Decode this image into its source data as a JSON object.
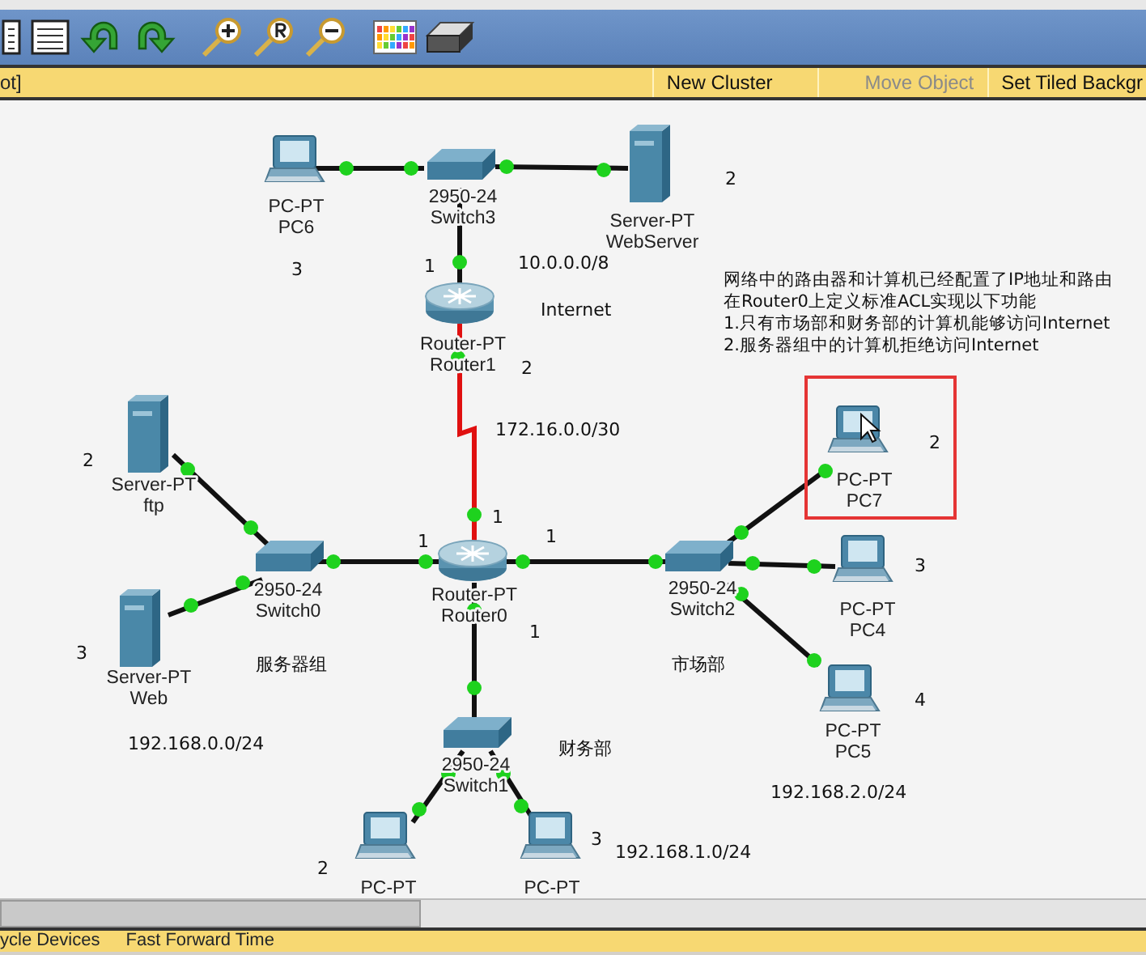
{
  "action_bar": {
    "left_text": "ot]",
    "buttons": [
      {
        "label": "New Cluster",
        "disabled": false
      },
      {
        "label": "Move Object",
        "disabled": true
      },
      {
        "label": "Set Tiled Backgr",
        "disabled": false
      }
    ]
  },
  "devices": [
    {
      "kind": "pc",
      "model": "PC-PT",
      "name": "PC6",
      "selected": false
    },
    {
      "kind": "switch",
      "model": "2950-24",
      "name": "Switch3",
      "selected": false
    },
    {
      "kind": "server",
      "model": "Server-PT",
      "name": "WebServer",
      "selected": false
    },
    {
      "kind": "router",
      "model": "Router-PT",
      "name": "Router1",
      "selected": false
    },
    {
      "kind": "server",
      "model": "Server-PT",
      "name": "ftp",
      "selected": false
    },
    {
      "kind": "switch",
      "model": "2950-24",
      "name": "Switch0",
      "selected": false
    },
    {
      "kind": "router",
      "model": "Router-PT",
      "name": "Router0",
      "selected": false
    },
    {
      "kind": "switch",
      "model": "2950-24",
      "name": "Switch2",
      "selected": false
    },
    {
      "kind": "pc",
      "model": "PC-PT",
      "name": "PC7",
      "selected": true
    },
    {
      "kind": "pc",
      "model": "PC-PT",
      "name": "PC4",
      "selected": false
    },
    {
      "kind": "server",
      "model": "Server-PT",
      "name": "Web",
      "selected": false
    },
    {
      "kind": "pc",
      "model": "PC-PT",
      "name": "PC5",
      "selected": false
    },
    {
      "kind": "switch",
      "model": "2950-24",
      "name": "Switch1",
      "selected": false
    },
    {
      "kind": "pc",
      "model": "PC-PT",
      "selected": false
    },
    {
      "kind": "pc",
      "model": "PC-PT",
      "selected": false
    }
  ],
  "links": [
    {
      "kind": "ethernet"
    },
    {
      "kind": "ethernet"
    },
    {
      "kind": "ethernet"
    },
    {
      "kind": "serial"
    },
    {
      "kind": "ethernet"
    },
    {
      "kind": "ethernet"
    },
    {
      "kind": "ethernet"
    },
    {
      "kind": "ethernet"
    },
    {
      "kind": "ethernet"
    },
    {
      "kind": "ethernet"
    },
    {
      "kind": "ethernet"
    },
    {
      "kind": "ethernet"
    },
    {
      "kind": "ethernet"
    },
    {
      "kind": "ethernet"
    }
  ],
  "labels": [
    "3",
    "1",
    "10.0.0.0/8",
    "Internet",
    "2",
    "2",
    "172.16.0.0/30",
    "2",
    "1",
    "1",
    "1",
    "3",
    "1",
    "服务器组",
    "市场部",
    "192.168.0.0/24",
    "财务部",
    "192.168.2.0/24",
    "192.168.1.0/24",
    "2",
    "3",
    "2",
    "3",
    "4"
  ],
  "note": [
    "网络中的路由器和计算机已经配置了IP地址和路由",
    "在Router0上定义标准ACL实现以下功能",
    "1.只有市场部和财务部的计算机能够访问Internet",
    "2.服务器组中的计算机拒绝访问Internet"
  ],
  "status_bar": [
    "ycle Devices",
    "Fast Forward Time"
  ]
}
